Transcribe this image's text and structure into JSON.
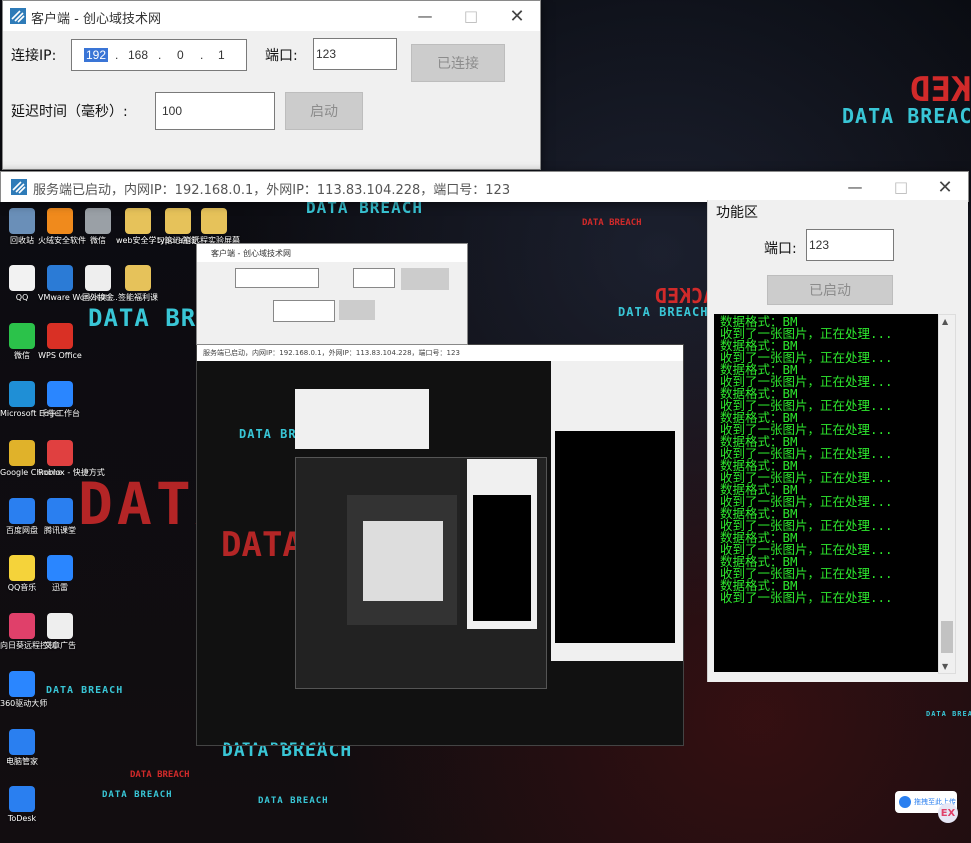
{
  "client": {
    "title": "客户端 - 创心域技术网",
    "ip_label": "连接IP:",
    "ip": [
      "192",
      "168",
      "0",
      "1"
    ],
    "port_label": "端口:",
    "port": "123",
    "connect_label": "已连接",
    "delay_label": "延迟时间（毫秒）:",
    "delay": "100",
    "start_label": "启动"
  },
  "server": {
    "title": "服务端已启动，内网IP：192.168.0.1，外网IP：113.83.104.228，端口号：123",
    "panel_title": "功能区",
    "port_label": "端口:",
    "port": "123",
    "started_label": "已启动",
    "log": [
      "数据格式：BM",
      "收到了一张图片，正在处理...",
      "数据格式：BM",
      "收到了一张图片，正在处理...",
      "数据格式：BM",
      "收到了一张图片，正在处理...",
      "数据格式：BM",
      "收到了一张图片，正在处理...",
      "数据格式：BM",
      "收到了一张图片，正在处理...",
      "数据格式：BM",
      "收到了一张图片，正在处理...",
      "数据格式：BM",
      "收到了一张图片，正在处理...",
      "数据格式：BM",
      "收到了一张图片，正在处理...",
      "数据格式：BM",
      "收到了一张图片，正在处理...",
      "数据格式：BM",
      "收到了一张图片，正在处理...",
      "数据格式：BM",
      "收到了一张图片，正在处理...",
      "数据格式：BM",
      "收到了一张图片，正在处理..."
    ]
  },
  "wallpaper": {
    "data_breach": "DATA BREACH",
    "hacked": "HACKED"
  },
  "desktop_icons": [
    {
      "label": "回收站",
      "color": "#6a8fb8"
    },
    {
      "label": "火绒安全软件",
      "color": "#f08a1c"
    },
    {
      "label": "微信",
      "color": "#9aa0a6"
    },
    {
      "label": "web安全学习笔记总结",
      "color": "#e6c25a"
    },
    {
      "label": "typora笔记",
      "color": "#e6c25a"
    },
    {
      "label": "远程实验屏幕",
      "color": "#e6c25a"
    },
    {
      "label": "QQ",
      "color": "#f2f2f2"
    },
    {
      "label": "VMware Workstati...",
      "color": "#2b7bd6"
    },
    {
      "label": "国外换金",
      "color": "#eeeeee"
    },
    {
      "label": "签能福利课",
      "color": "#e6c25a"
    },
    {
      "label": "微信",
      "color": "#2bc24a"
    },
    {
      "label": "WPS Office",
      "color": "#d93025"
    },
    {
      "label": "Microsoft Edge",
      "color": "#1f8fd6"
    },
    {
      "label": "千牛工作台",
      "color": "#2a86ff"
    },
    {
      "label": "Google Chrome",
      "color": "#e0b22a"
    },
    {
      "label": "Roblox - 快捷方式",
      "color": "#e04040"
    },
    {
      "label": "百度网盘",
      "color": "#2a7ff0"
    },
    {
      "label": "腾讯课堂",
      "color": "#2a7ff0"
    },
    {
      "label": "QQ音乐",
      "color": "#f5d33a"
    },
    {
      "label": "迅雷",
      "color": "#2a86ff"
    },
    {
      "label": "向日葵远程控制",
      "color": "#e0406a"
    },
    {
      "label": "文章广告",
      "color": "#eeeeee"
    },
    {
      "label": "360驱动大师",
      "color": "#2a86ff"
    },
    {
      "label": "电脑管家",
      "color": "#2a7ff0"
    },
    {
      "label": "ToDesk",
      "color": "#2a7ff0"
    }
  ],
  "tray": {
    "label": "拖拽至此上传"
  }
}
